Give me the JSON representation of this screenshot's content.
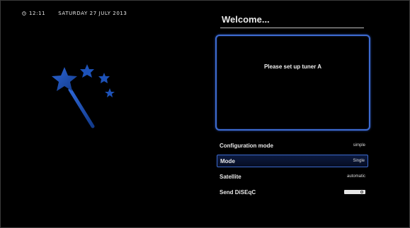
{
  "status": {
    "time": "12:11",
    "date": "SATURDAY 27 JULY 2013"
  },
  "wizard": {
    "title": "Welcome...",
    "message": "Please set up tuner A"
  },
  "menu": {
    "rows": [
      {
        "label": "Configuration mode",
        "value": "simple",
        "selected": false
      },
      {
        "label": "Mode",
        "value": "Single",
        "selected": true
      },
      {
        "label": "Satellite",
        "value": "automatic",
        "selected": false
      },
      {
        "label": "Send DiSEqC",
        "toggle": true,
        "toggle_state": "off",
        "selected": false
      }
    ]
  },
  "icons": {
    "clock": "clock-icon",
    "wand": "magic-wand-icon",
    "toggle": "toggle-switch-icon"
  },
  "colors": {
    "background": "#000000",
    "accent": "#3d6bd0",
    "wand_blue": "#1c4fb0",
    "text": "#e8e8e8"
  }
}
